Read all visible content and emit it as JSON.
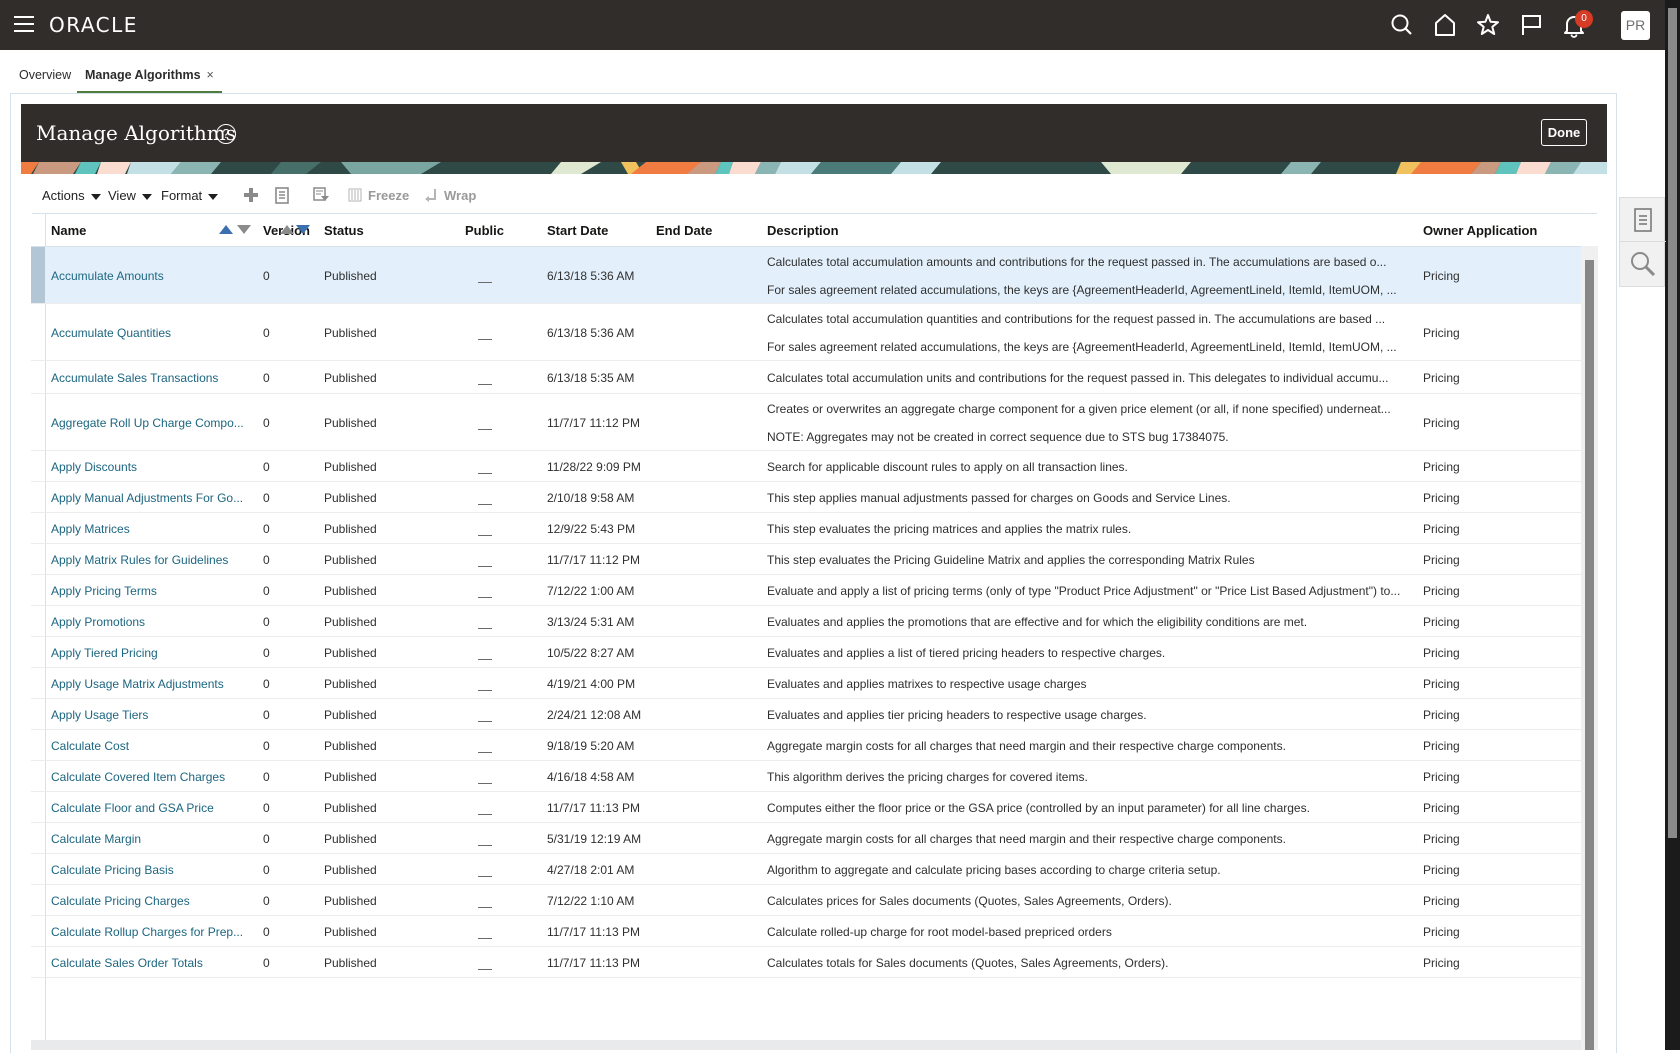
{
  "global_header": {
    "brand": "ORACLE",
    "icons": [
      "hamburger-menu-icon",
      "search-icon",
      "home-icon",
      "star-icon",
      "flag-icon",
      "bell-icon"
    ],
    "notification_count": "0",
    "user_initials": "PR"
  },
  "tabs": [
    {
      "label": "Overview",
      "active": false
    },
    {
      "label": "Manage Algorithms",
      "active": true,
      "close": "×"
    }
  ],
  "page": {
    "title": "Manage Algorithms",
    "help": "?",
    "done_label": "Done"
  },
  "toolbar": {
    "actions_label": "Actions",
    "view_label": "View",
    "format_label": "Format",
    "icons": [
      "add-icon",
      "edit-icon",
      "query-by-example-icon"
    ],
    "freeze_label": "Freeze",
    "wrap_label": "Wrap"
  },
  "table": {
    "columns": [
      "Name",
      "Version",
      "Status",
      "Public",
      "Start Date",
      "End Date",
      "Description",
      "Owner Application"
    ],
    "rows": [
      {
        "name": "Accumulate Amounts",
        "version": "0",
        "status": "Published",
        "public": "—",
        "start": "6/13/18 5:36 AM",
        "end": "",
        "desc": [
          "Calculates total accumulation amounts and contributions for the request passed in. The accumulations are based o...",
          "For sales agreement related accumulations, the keys are {AgreementHeaderId, AgreementLineId, ItemId, ItemUOM, ..."
        ],
        "owner": "Pricing",
        "selected": true
      },
      {
        "name": "Accumulate Quantities",
        "version": "0",
        "status": "Published",
        "public": "—",
        "start": "6/13/18 5:36 AM",
        "end": "",
        "desc": [
          "Calculates total accumulation quantities and contributions for the request passed in. The accumulations are based ...",
          "For sales agreement related accumulations, the keys are {AgreementHeaderId, AgreementLineId, ItemId, ItemUOM, ..."
        ],
        "owner": "Pricing"
      },
      {
        "name": "Accumulate Sales Transactions",
        "version": "0",
        "status": "Published",
        "public": "—",
        "start": "6/13/18 5:35 AM",
        "end": "",
        "desc": [
          "Calculates total accumulation units and contributions for the request passed in. This delegates to individual accumu..."
        ],
        "owner": "Pricing"
      },
      {
        "name": "Aggregate Roll Up Charge Compo...",
        "version": "0",
        "status": "Published",
        "public": "—",
        "start": "11/7/17 11:12 PM",
        "end": "",
        "desc": [
          "Creates or overwrites an aggregate charge component for a given price element (or all, if none specified) underneat...",
          "NOTE: Aggregates may not be created in correct sequence due to STS bug 17384075."
        ],
        "owner": "Pricing"
      },
      {
        "name": "Apply Discounts",
        "version": "0",
        "status": "Published",
        "public": "—",
        "start": "11/28/22 9:09 PM",
        "end": "",
        "desc": [
          "Search for applicable discount rules to apply on all transaction lines."
        ],
        "owner": "Pricing"
      },
      {
        "name": "Apply Manual Adjustments For Go...",
        "version": "0",
        "status": "Published",
        "public": "—",
        "start": "2/10/18 9:58 AM",
        "end": "",
        "desc": [
          "This step applies manual adjustments passed for charges on Goods and Service Lines."
        ],
        "owner": "Pricing"
      },
      {
        "name": "Apply Matrices",
        "version": "0",
        "status": "Published",
        "public": "—",
        "start": "12/9/22 5:43 PM",
        "end": "",
        "desc": [
          "This step evaluates the pricing matrices and applies the matrix rules."
        ],
        "owner": "Pricing"
      },
      {
        "name": "Apply Matrix Rules for Guidelines",
        "version": "0",
        "status": "Published",
        "public": "—",
        "start": "11/7/17 11:12 PM",
        "end": "",
        "desc": [
          "This step evaluates the Pricing Guideline Matrix and applies the corresponding Matrix Rules"
        ],
        "owner": "Pricing"
      },
      {
        "name": "Apply Pricing Terms",
        "version": "0",
        "status": "Published",
        "public": "—",
        "start": "7/12/22 1:00 AM",
        "end": "",
        "desc": [
          "Evaluate and apply a list of pricing terms (only of type \"Product Price Adjustment\" or \"Price List Based Adjustment\") to..."
        ],
        "owner": "Pricing"
      },
      {
        "name": "Apply Promotions",
        "version": "0",
        "status": "Published",
        "public": "—",
        "start": "3/13/24 5:31 AM",
        "end": "",
        "desc": [
          "Evaluates and applies the promotions that are effective and for which the eligibility conditions are met."
        ],
        "owner": "Pricing"
      },
      {
        "name": "Apply Tiered Pricing",
        "version": "0",
        "status": "Published",
        "public": "—",
        "start": "10/5/22 8:27 AM",
        "end": "",
        "desc": [
          "Evaluates and applies a list of tiered pricing headers to respective charges."
        ],
        "owner": "Pricing"
      },
      {
        "name": "Apply Usage Matrix Adjustments",
        "version": "0",
        "status": "Published",
        "public": "—",
        "start": "4/19/21 4:00 PM",
        "end": "",
        "desc": [
          "Evaluates and applies matrixes to respective usage charges"
        ],
        "owner": "Pricing"
      },
      {
        "name": "Apply Usage Tiers",
        "version": "0",
        "status": "Published",
        "public": "—",
        "start": "2/24/21 12:08 AM",
        "end": "",
        "desc": [
          "Evaluates and applies tier pricing headers to respective usage charges."
        ],
        "owner": "Pricing"
      },
      {
        "name": "Calculate Cost",
        "version": "0",
        "status": "Published",
        "public": "—",
        "start": "9/18/19 5:20 AM",
        "end": "",
        "desc": [
          "Aggregate margin costs for all charges that need margin and their respective charge components."
        ],
        "owner": "Pricing"
      },
      {
        "name": "Calculate Covered Item Charges",
        "version": "0",
        "status": "Published",
        "public": "—",
        "start": "4/16/18 4:58 AM",
        "end": "",
        "desc": [
          "This algorithm derives the pricing charges for covered items."
        ],
        "owner": "Pricing"
      },
      {
        "name": "Calculate Floor and GSA Price",
        "version": "0",
        "status": "Published",
        "public": "—",
        "start": "11/7/17 11:13 PM",
        "end": "",
        "desc": [
          "Computes either the floor price or the GSA price (controlled by an input parameter) for all line charges."
        ],
        "owner": "Pricing"
      },
      {
        "name": "Calculate Margin",
        "version": "0",
        "status": "Published",
        "public": "—",
        "start": "5/31/19 12:19 AM",
        "end": "",
        "desc": [
          "Aggregate margin costs for all charges that need margin and their respective charge components."
        ],
        "owner": "Pricing"
      },
      {
        "name": "Calculate Pricing Basis",
        "version": "0",
        "status": "Published",
        "public": "—",
        "start": "4/27/18 2:01 AM",
        "end": "",
        "desc": [
          "Algorithm to aggregate and calculate pricing bases according to charge criteria setup."
        ],
        "owner": "Pricing"
      },
      {
        "name": "Calculate Pricing Charges",
        "version": "0",
        "status": "Published",
        "public": "—",
        "start": "7/12/22 1:10 AM",
        "end": "",
        "desc": [
          "Calculates prices for Sales documents (Quotes, Sales Agreements, Orders)."
        ],
        "owner": "Pricing"
      },
      {
        "name": "Calculate Rollup Charges for Prep...",
        "version": "0",
        "status": "Published",
        "public": "—",
        "start": "11/7/17 11:13 PM",
        "end": "",
        "desc": [
          "Calculate rolled-up charge for root model-based prepriced orders"
        ],
        "owner": "Pricing"
      },
      {
        "name": "Calculate Sales Order Totals",
        "version": "0",
        "status": "Published",
        "public": "—",
        "start": "11/7/17 11:13 PM",
        "end": "",
        "desc": [
          "Calculates totals for Sales documents (Quotes, Sales Agreements, Orders)."
        ],
        "owner": "Pricing"
      }
    ]
  },
  "side_panel": {
    "icons": [
      "document-icon",
      "search-icon"
    ]
  },
  "colors": {
    "header_bg": "#312d2a",
    "link": "#1c6680",
    "selected_row": "#e3f0fb",
    "active_tab_underline": "#4f7d3d",
    "badge": "#d63b25",
    "sort_active": "#3c6fb0"
  }
}
